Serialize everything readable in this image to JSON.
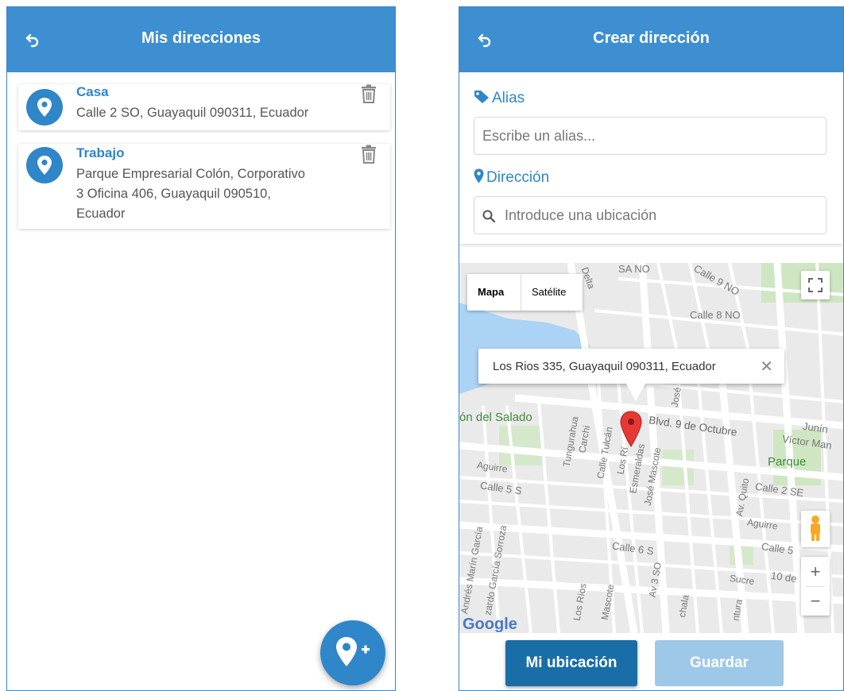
{
  "left": {
    "header": {
      "title": "Mis direcciones"
    },
    "addresses": [
      {
        "alias": "Casa",
        "lines": [
          "Calle 2 SO, Guayaquil 090311, Ecuador"
        ]
      },
      {
        "alias": "Trabajo",
        "lines": [
          "Parque Empresarial Colón, Corporativo",
          "3 Oficina 406, Guayaquil 090510,",
          "Ecuador"
        ]
      }
    ],
    "fab": {
      "icon": "add-location-icon"
    }
  },
  "right": {
    "header": {
      "title": "Crear dirección"
    },
    "alias": {
      "label": "Alias",
      "placeholder": "Escribe un alias..."
    },
    "direccion": {
      "label": "Dirección",
      "placeholder": "Introduce una ubicación"
    },
    "map": {
      "type_options": [
        "Mapa",
        "Satélite"
      ],
      "selected_type": "Mapa",
      "info_window": "Los Rios 335, Guayaquil 090311, Ecuador",
      "labels": {
        "calle9no": "Calle 9 NO",
        "calle8no": "Calle 8 NO",
        "sano": "SA NO",
        "delta": "Delta",
        "salado": "ón del Salado",
        "blvd": "Blvd. 9 de Octubre",
        "tungurahua": "Tungurahua",
        "carchi": "Carchi",
        "tulcan": "Calle Tulcán",
        "losrios": "Los Rí",
        "esmeraldas": "Esmeraldas",
        "mascote": "José Mascote",
        "aguirre": "Aguirre",
        "calle5s": "Calle 5 S",
        "calle6s": "Calle 6 S",
        "av3so": "Av 3 SO",
        "quito": "Av. Quito",
        "calle2se": "Calle 2 SE",
        "parque": "Parque",
        "junin": "Junín",
        "victorman": "Víctor Man",
        "aguirre2": "Aguirre",
        "calle5": "Calle 5",
        "sucre": "Sucre",
        "diez": "10 de",
        "andres": "Andrés Marín García",
        "sorroza": "zardo García Sorroza",
        "losrios2": "Los Ríos",
        "mascote2": "Mascote",
        "chala": "chala",
        "tura": "ntura",
        "jose": "José",
        "google": "Google"
      }
    },
    "buttons": {
      "ubicacion": "Mi ubicación",
      "guardar": "Guardar"
    }
  },
  "colors": {
    "primary": "#3d8fd1",
    "accent": "#2f86c9",
    "dark_button": "#1a6ea8",
    "disabled_button": "#9ec8e8",
    "marker": "#e53935"
  }
}
